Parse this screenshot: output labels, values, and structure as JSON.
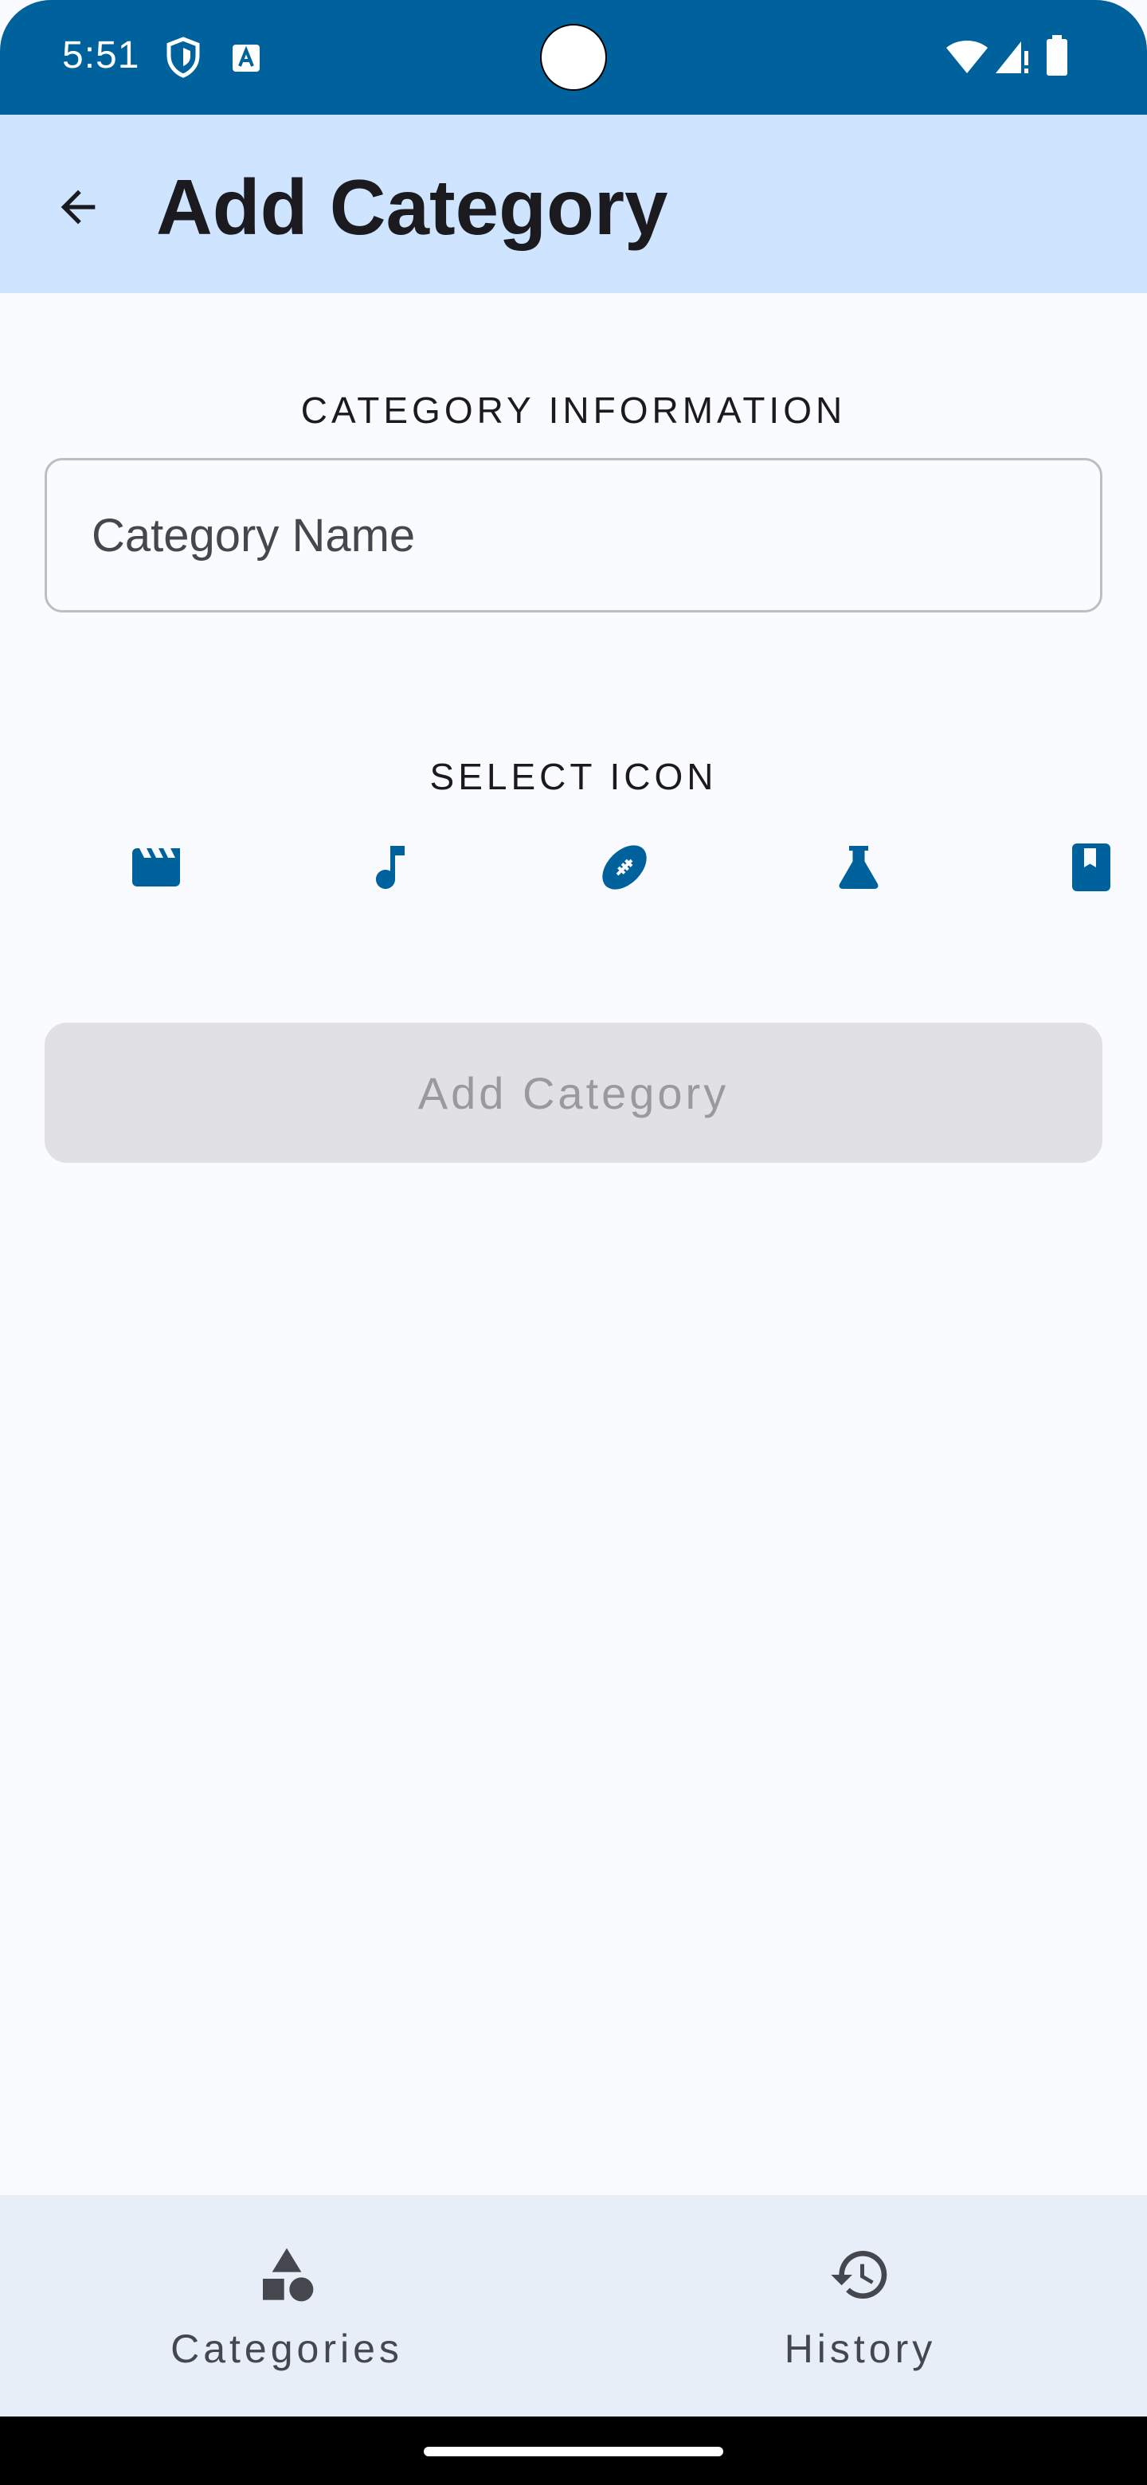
{
  "status_bar": {
    "time": "5:51",
    "icons": [
      "shield-icon",
      "keyboard-a-icon",
      "wifi-icon",
      "signal-icon",
      "battery-icon"
    ]
  },
  "app_bar": {
    "back_icon": "arrow-back-icon",
    "title": "Add Category"
  },
  "form": {
    "info_section_label": "CATEGORY INFORMATION",
    "name_field": {
      "placeholder": "Category Name",
      "value": ""
    },
    "icon_section_label": "SELECT ICON",
    "icons": [
      "movie-clapperboard-icon",
      "music-note-icon",
      "football-icon",
      "science-flask-icon",
      "book-icon"
    ],
    "submit_label": "Add Category"
  },
  "bottom_nav": {
    "items": [
      {
        "label": "Categories",
        "icon": "categories-shapes-icon"
      },
      {
        "label": "History",
        "icon": "history-icon"
      }
    ]
  },
  "colors": {
    "status_bar": "#00629c",
    "app_bar": "#cfe5ff",
    "accent": "#00629c",
    "disabled_button": "#e1e1e4",
    "bottom_nav": "#e7eef7"
  }
}
